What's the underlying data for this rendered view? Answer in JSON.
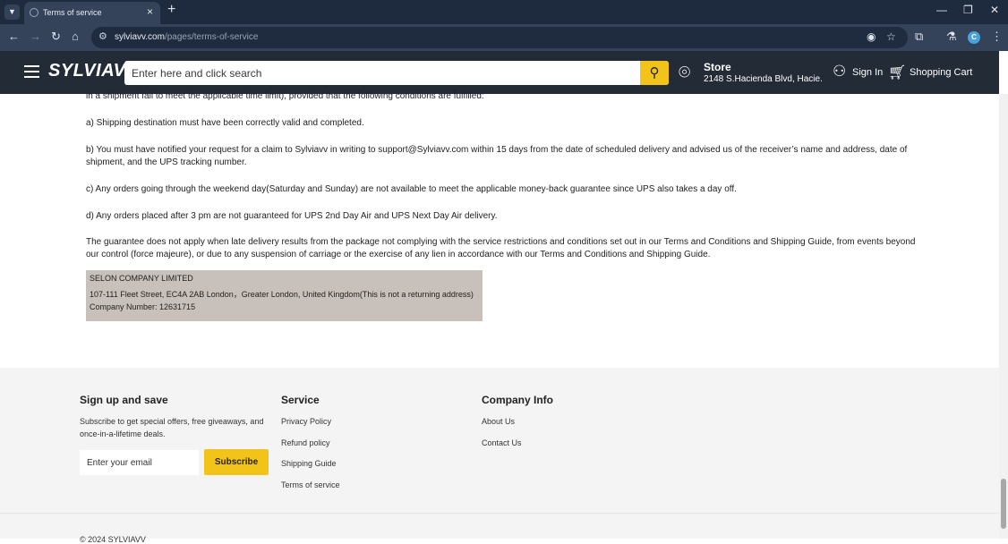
{
  "browser": {
    "tab_title": "Terms of service",
    "url_host": "sylviavv.com",
    "url_path": "/pages/terms-of-service",
    "profile_initial": "C"
  },
  "header": {
    "logo": "SYLVIAVV",
    "search_placeholder": "Enter here and click search",
    "store_title": "Store",
    "store_address": "2148 S.Hacienda Blvd, Hacie...",
    "sign_in": "Sign In",
    "cart": "Shopping Cart"
  },
  "content": {
    "paragraphs": [
      "in a shipment fail to meet the applicable time limit), provided that the following conditions are fulfilled:",
      "a) Shipping destination must have been correctly valid and completed.",
      "b) You must have notified your request for a claim to Sylviavv in writing to support@Sylviavv.com within 15 days from the date of scheduled delivery and advised us of the receiver’s name and address, date of shipment, and the UPS tracking number.",
      "c) Any orders going through the weekend day(Saturday and Sunday) are not available to meet the applicable money-back guarantee since UPS also takes a day off.",
      "d) Any orders placed after 3 pm are not guaranteed for UPS 2nd Day Air and UPS Next Day Air delivery.",
      "The guarantee does not apply when late delivery results from the package not complying with the service restrictions and conditions set out in our Terms and Conditions and Shipping Guide, from events beyond our control (force majeure), or due to any suspension of carriage or the exercise of any lien in accordance with our Terms and Conditions and Shipping Guide."
    ],
    "address_box": [
      "SELON COMPANY LIMITED",
      "107-111 Fleet Street, EC4A 2AB London，Greater London, United Kingdom(This is not a returning address)",
      "Company Number: 12631715"
    ]
  },
  "footer": {
    "signup_title": "Sign up and save",
    "signup_text_1": "Subscribe to get special offers, free giveaways, and",
    "signup_text_2": "once-in-a-lifetime deals.",
    "email_placeholder": "Enter your email",
    "subscribe": "Subscribe",
    "service_title": "Service",
    "service_links": [
      "Privacy Policy",
      "Refund policy",
      "Shipping Guide",
      "Terms of service"
    ],
    "company_title": "Company Info",
    "company_links": [
      "About Us",
      "Contact Us"
    ],
    "copyright": "© 2024 SYLVIAVV"
  }
}
